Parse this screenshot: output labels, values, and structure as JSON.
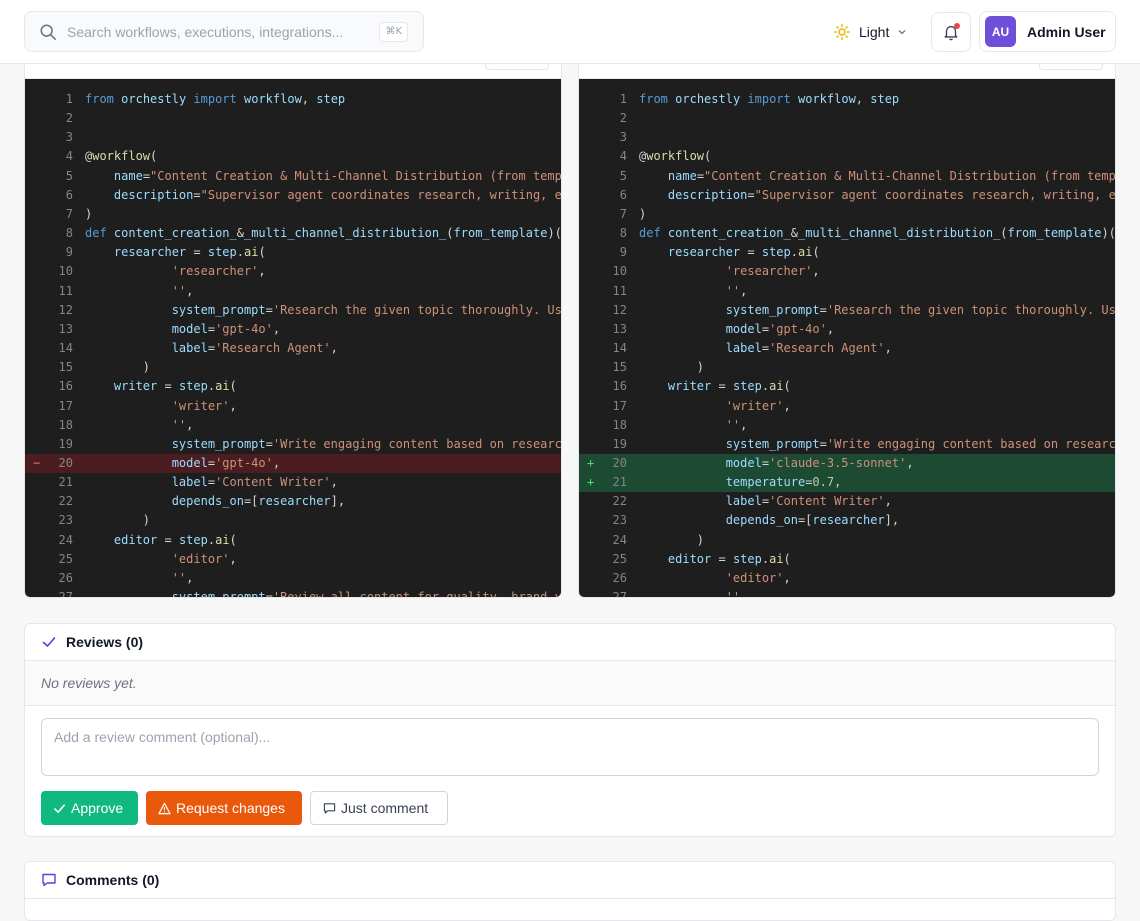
{
  "header": {
    "search_placeholder": "Search workflows, executions, integrations...",
    "search_shortcut": "⌘K",
    "theme_label": "Light",
    "user_initials": "AU",
    "user_name": "Admin User"
  },
  "diff": {
    "left": [
      {
        "n": "1",
        "m": "",
        "c": "from orchestly import workflow, step"
      },
      {
        "n": "2",
        "m": "",
        "c": ""
      },
      {
        "n": "3",
        "m": "",
        "c": ""
      },
      {
        "n": "4",
        "m": "",
        "c": "@workflow("
      },
      {
        "n": "5",
        "m": "",
        "c": "    name=\"Content Creation & Multi-Channel Distribution (from template)\","
      },
      {
        "n": "6",
        "m": "",
        "c": "    description=\"Supervisor agent coordinates research, writing, editing\","
      },
      {
        "n": "7",
        "m": "",
        "c": ")"
      },
      {
        "n": "8",
        "m": "",
        "c": "def content_creation_&_multi_channel_distribution_(from_template)(ctx):"
      },
      {
        "n": "9",
        "m": "",
        "c": "    researcher = step.ai("
      },
      {
        "n": "10",
        "m": "",
        "c": "            'researcher',"
      },
      {
        "n": "11",
        "m": "",
        "c": "            '',"
      },
      {
        "n": "12",
        "m": "",
        "c": "            system_prompt='Research the given topic thoroughly. Use sources.',"
      },
      {
        "n": "13",
        "m": "",
        "c": "            model='gpt-4o',"
      },
      {
        "n": "14",
        "m": "",
        "c": "            label='Research Agent',"
      },
      {
        "n": "15",
        "m": "",
        "c": "        )"
      },
      {
        "n": "16",
        "m": "",
        "c": "    writer = step.ai("
      },
      {
        "n": "17",
        "m": "",
        "c": "            'writer',"
      },
      {
        "n": "18",
        "m": "",
        "c": "            '',"
      },
      {
        "n": "19",
        "m": "",
        "c": "            system_prompt='Write engaging content based on research.',"
      },
      {
        "n": "20",
        "m": "−",
        "c": "            model='gpt-4o',",
        "type": "del"
      },
      {
        "n": "21",
        "m": "",
        "c": "            label='Content Writer',"
      },
      {
        "n": "22",
        "m": "",
        "c": "            depends_on=[researcher],"
      },
      {
        "n": "23",
        "m": "",
        "c": "        )"
      },
      {
        "n": "24",
        "m": "",
        "c": "    editor = step.ai("
      },
      {
        "n": "25",
        "m": "",
        "c": "            'editor',"
      },
      {
        "n": "26",
        "m": "",
        "c": "            '',"
      },
      {
        "n": "27",
        "m": "",
        "c": "            system_prompt='Review all content for quality, brand voice.',"
      }
    ],
    "right": [
      {
        "n": "1",
        "m": "",
        "c": "from orchestly import workflow, step"
      },
      {
        "n": "2",
        "m": "",
        "c": ""
      },
      {
        "n": "3",
        "m": "",
        "c": ""
      },
      {
        "n": "4",
        "m": "",
        "c": "@workflow("
      },
      {
        "n": "5",
        "m": "",
        "c": "    name=\"Content Creation & Multi-Channel Distribution (from template)\","
      },
      {
        "n": "6",
        "m": "",
        "c": "    description=\"Supervisor agent coordinates research, writing, editing\","
      },
      {
        "n": "7",
        "m": "",
        "c": ")"
      },
      {
        "n": "8",
        "m": "",
        "c": "def content_creation_&_multi_channel_distribution_(from_template)(ctx):"
      },
      {
        "n": "9",
        "m": "",
        "c": "    researcher = step.ai("
      },
      {
        "n": "10",
        "m": "",
        "c": "            'researcher',"
      },
      {
        "n": "11",
        "m": "",
        "c": "            '',"
      },
      {
        "n": "12",
        "m": "",
        "c": "            system_prompt='Research the given topic thoroughly. Use sources.',"
      },
      {
        "n": "13",
        "m": "",
        "c": "            model='gpt-4o',"
      },
      {
        "n": "14",
        "m": "",
        "c": "            label='Research Agent',"
      },
      {
        "n": "15",
        "m": "",
        "c": "        )"
      },
      {
        "n": "16",
        "m": "",
        "c": "    writer = step.ai("
      },
      {
        "n": "17",
        "m": "",
        "c": "            'writer',"
      },
      {
        "n": "18",
        "m": "",
        "c": "            '',"
      },
      {
        "n": "19",
        "m": "",
        "c": "            system_prompt='Write engaging content based on research.',"
      },
      {
        "n": "20",
        "m": "+",
        "c": "            model='claude-3.5-sonnet',",
        "type": "add"
      },
      {
        "n": "21",
        "m": "+",
        "c": "            temperature=0.7,",
        "type": "add"
      },
      {
        "n": "22",
        "m": "",
        "c": "            label='Content Writer',"
      },
      {
        "n": "23",
        "m": "",
        "c": "            depends_on=[researcher],"
      },
      {
        "n": "24",
        "m": "",
        "c": "        )"
      },
      {
        "n": "25",
        "m": "",
        "c": "    editor = step.ai("
      },
      {
        "n": "26",
        "m": "",
        "c": "            'editor',"
      },
      {
        "n": "27",
        "m": "",
        "c": "            '',"
      }
    ]
  },
  "reviews": {
    "title": "Reviews (0)",
    "empty_text": "No reviews yet.",
    "comment_placeholder": "Add a review comment (optional)...",
    "approve_label": "Approve",
    "request_changes_label": "Request changes",
    "just_comment_label": "Just comment"
  },
  "comments": {
    "title": "Comments (0)"
  },
  "colors": {
    "approve": "#10b981",
    "request_changes": "#ea580c",
    "avatar": "#6d4fd9",
    "deleted_line_bg": "#4b1d20",
    "added_line_bg": "#1c4a33",
    "code_bg": "#1e1e1e"
  }
}
